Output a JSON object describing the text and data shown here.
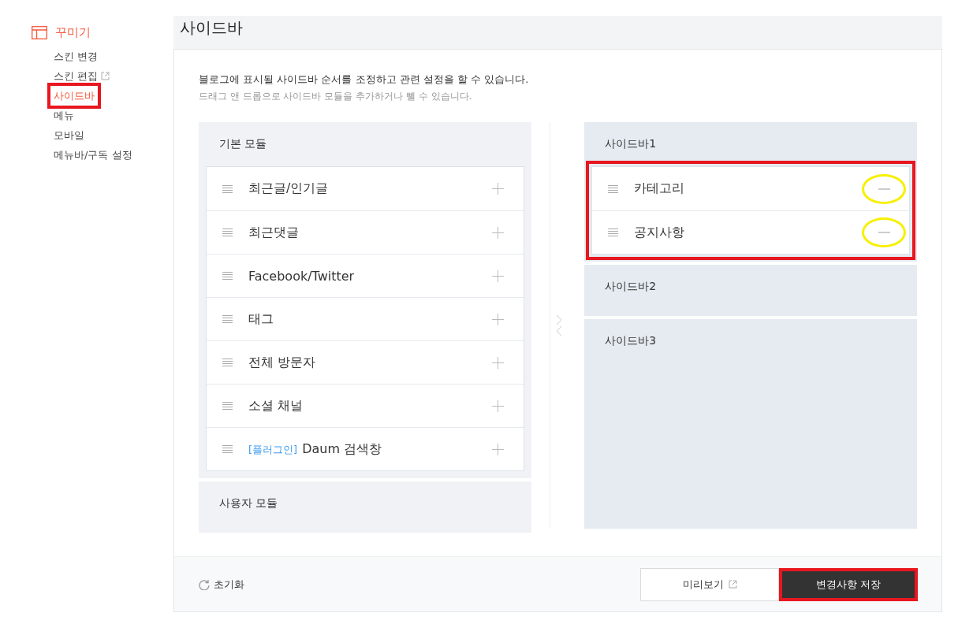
{
  "nav": {
    "title": "꾸미기",
    "items": [
      {
        "label": "스킨 변경",
        "selected": false,
        "external": false,
        "highlighted": false
      },
      {
        "label": "스킨 편집",
        "selected": false,
        "external": true,
        "highlighted": false
      },
      {
        "label": "사이드바",
        "selected": true,
        "external": false,
        "highlighted": true
      },
      {
        "label": "메뉴",
        "selected": false,
        "external": false,
        "highlighted": false
      },
      {
        "label": "모바일",
        "selected": false,
        "external": false,
        "highlighted": false
      },
      {
        "label": "메뉴바/구독 설정",
        "selected": false,
        "external": false,
        "highlighted": false
      }
    ]
  },
  "page_title": "사이드바",
  "description": [
    "블로그에 표시될 사이드바 순서를 조정하고 관련 설정을 할 수 있습니다.",
    "드래그 앤 드롭으로 사이드바 모듈을 추가하거나 뺄 수 있습니다."
  ],
  "basic_modules": {
    "title": "기본 모듈",
    "items": [
      {
        "label": "최근글/인기글"
      },
      {
        "label": "최근댓글"
      },
      {
        "label": "Facebook/Twitter"
      },
      {
        "label": "태그"
      },
      {
        "label": "전체 방문자"
      },
      {
        "label": "소셜 채널"
      },
      {
        "tag": "[플러그인]",
        "label": "Daum 검색창"
      }
    ]
  },
  "user_modules": {
    "title": "사용자 모듈"
  },
  "sidebars": [
    {
      "title": "사이드바1",
      "highlighted": true,
      "items": [
        {
          "label": "카테고리",
          "circled": true
        },
        {
          "label": "공지사항",
          "circled": true
        }
      ]
    },
    {
      "title": "사이드바2"
    },
    {
      "title": "사이드바3"
    }
  ],
  "footer": {
    "reset": "초기화",
    "preview": "미리보기",
    "save": {
      "label": "변경사항 저장",
      "highlighted": true
    }
  }
}
